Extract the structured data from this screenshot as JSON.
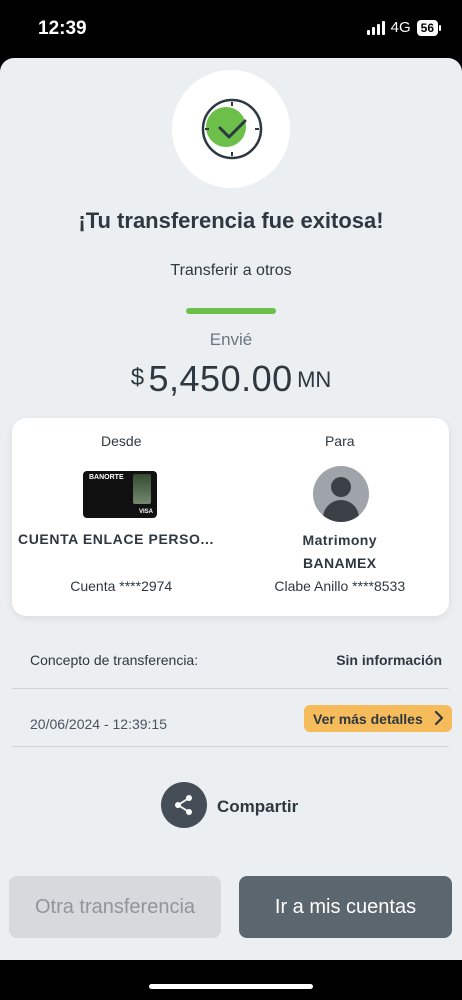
{
  "status_bar": {
    "time": "12:39",
    "network": "4G",
    "battery": "56"
  },
  "header": {
    "title": "¡Tu transferencia fue exitosa!",
    "subtitle": "Transferir a otros",
    "check_icon": "check-clock-icon"
  },
  "amount": {
    "label": "Envié",
    "symbol": "$",
    "value": "5,450.00",
    "currency": "MN"
  },
  "from": {
    "label": "Desde",
    "card_brand": "BANORTE",
    "card_network": "VISA",
    "account_name": "CUENTA ENLACE PERSO...",
    "account_number": "Cuenta ****2974"
  },
  "to": {
    "label": "Para",
    "name": "Matrimony",
    "bank": "BANAMEX",
    "clabe": "Clabe Anillo ****8533"
  },
  "concept": {
    "label": "Concepto de transferencia:",
    "value": "Sin información"
  },
  "details": {
    "date": "20/06/2024 - 12:39:15",
    "button_label": "Ver más detalles"
  },
  "share": {
    "label": "Compartir",
    "icon": "share-icon"
  },
  "actions": {
    "other_transfer": "Otra transferencia",
    "go_accounts": "Ir a mis cuentas"
  },
  "colors": {
    "accent_green": "#6cc04a",
    "details_orange": "#f6bb5a",
    "primary_button": "#5c666f"
  }
}
